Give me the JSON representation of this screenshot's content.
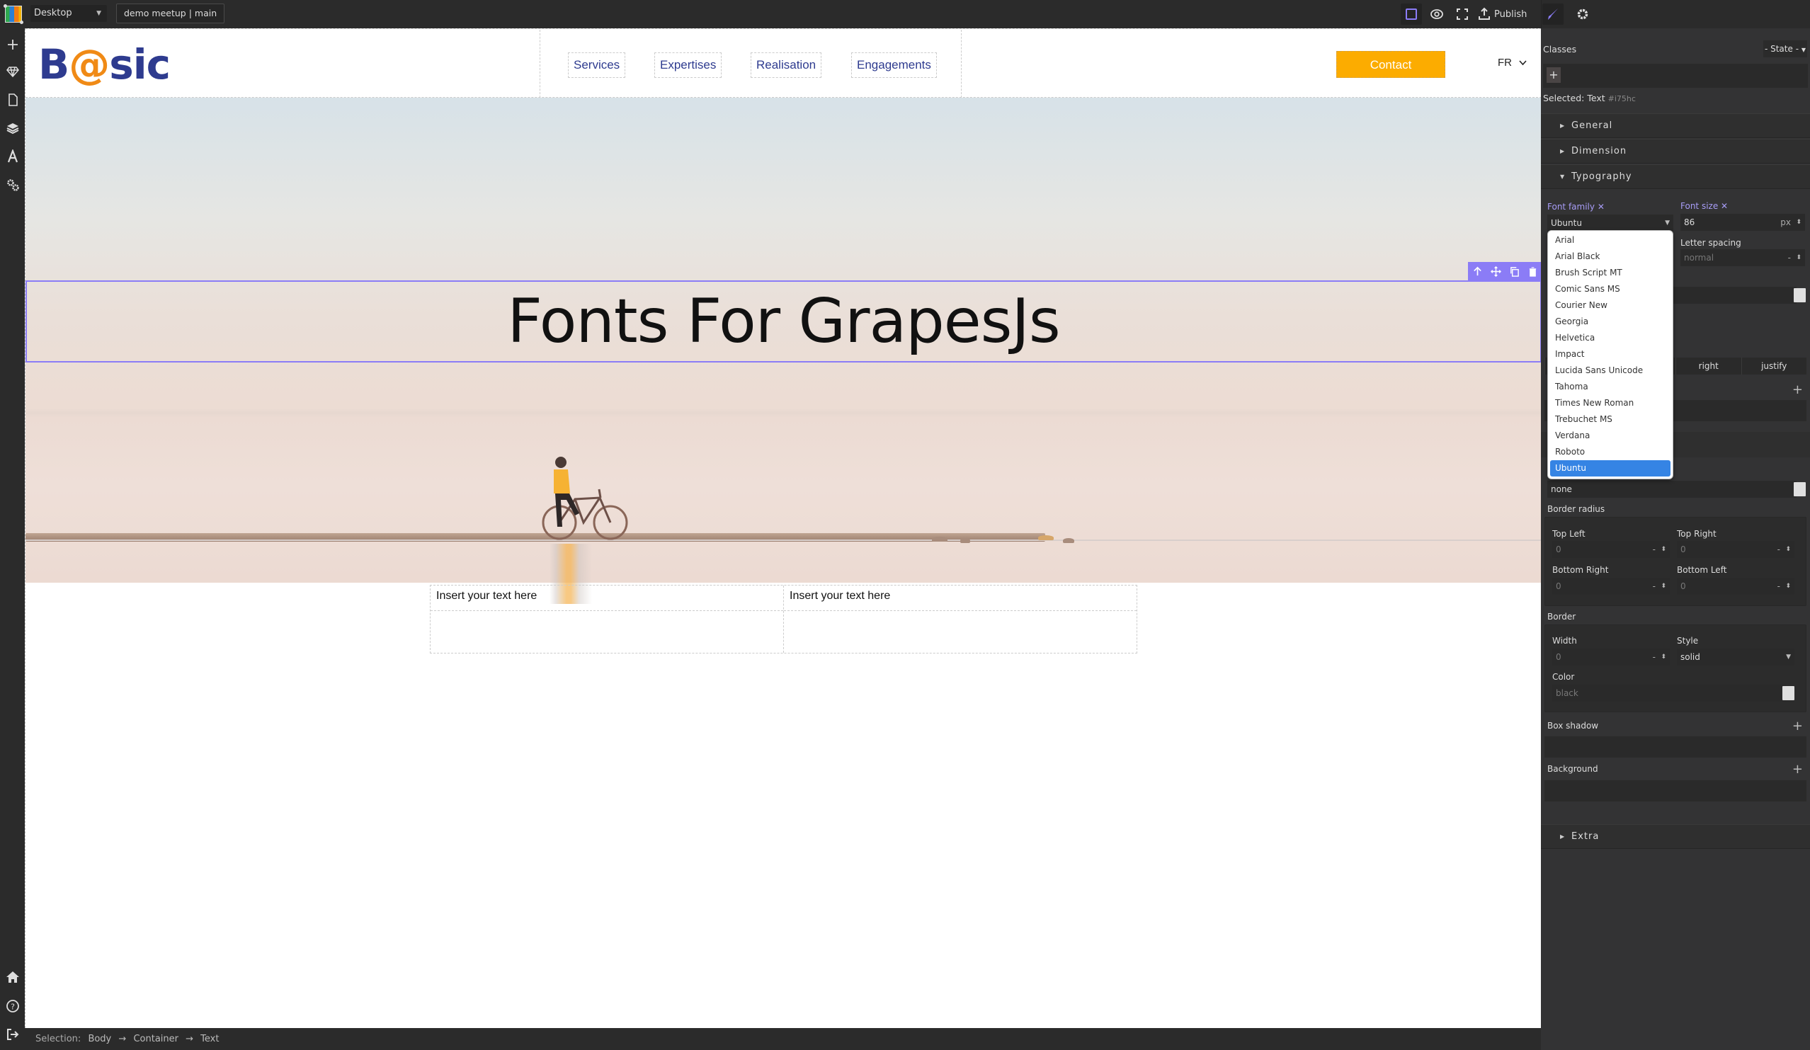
{
  "topbar": {
    "device": "Desktop",
    "project": "demo meetup | main",
    "publish_label": "Publish",
    "icons": [
      "square-outline-icon",
      "eye-icon",
      "fullscreen-icon",
      "upload-icon"
    ],
    "panel_tabs": [
      "paintbrush-icon",
      "gear-icon"
    ]
  },
  "sidebar": {
    "top_icons": [
      "plus-icon",
      "diamond-icon",
      "page-icon",
      "layers-icon",
      "font-icon",
      "gears-icon"
    ],
    "bottom_icons": [
      "home-icon",
      "help-icon",
      "logout-icon"
    ]
  },
  "site": {
    "logo": {
      "part1": "B",
      "at": "@",
      "part2": "sic"
    },
    "nav": [
      "Services",
      "Expertises",
      "Realisation",
      "Engagements"
    ],
    "contact_label": "Contact",
    "lang": "FR",
    "heading": "Fonts For GrapesJs",
    "cells": [
      "Insert your text here",
      "Insert your text here"
    ],
    "colors": {
      "brand_blue": "#2e3b8f",
      "brand_orange": "#f08a16",
      "contact_bg": "#fcac00",
      "selection": "#8b7cf6"
    }
  },
  "selection_toolbar": [
    "arrow-up-icon",
    "move-icon",
    "copy-icon",
    "trash-icon"
  ],
  "statusbar": {
    "label": "Selection:",
    "crumbs": [
      "Body",
      "Container",
      "Text"
    ]
  },
  "style_panel": {
    "classes_label": "Classes",
    "state_label": "- State -",
    "add_class": "+",
    "selected_label": "Selected:",
    "selected_type": "Text",
    "selected_id": "#i75hc",
    "sectors": {
      "general": "General",
      "dimension": "Dimension",
      "typography": "Typography",
      "extra": "Extra"
    },
    "typography": {
      "font_family_label": "Font family",
      "font_family_value": "Ubuntu",
      "font_size_label": "Font size",
      "font_size_value": "86",
      "font_size_unit": "px",
      "letter_spacing_label": "Letter spacing",
      "letter_spacing_value": "normal",
      "letter_spacing_unit": "-",
      "text_align_visible": [
        "right",
        "justify"
      ],
      "text_shadow_value": "none"
    },
    "font_options": [
      "Arial",
      "Arial Black",
      "Brush Script MT",
      "Comic Sans MS",
      "Courier New",
      "Georgia",
      "Helvetica",
      "Impact",
      "Lucida Sans Unicode",
      "Tahoma",
      "Times New Roman",
      "Trebuchet MS",
      "Verdana",
      "Roboto",
      "Ubuntu"
    ],
    "font_selected": "Ubuntu",
    "border_radius": {
      "label": "Border radius",
      "top_left_label": "Top Left",
      "top_left": "0",
      "top_right_label": "Top Right",
      "top_right": "0",
      "bottom_right_label": "Bottom Right",
      "bottom_right": "0",
      "bottom_left_label": "Bottom Left",
      "bottom_left": "0",
      "unit": "-"
    },
    "border": {
      "label": "Border",
      "width_label": "Width",
      "width": "0",
      "unit": "-",
      "style_label": "Style",
      "style": "solid",
      "color_label": "Color",
      "color": "black"
    },
    "box_shadow_label": "Box shadow",
    "background_label": "Background"
  }
}
